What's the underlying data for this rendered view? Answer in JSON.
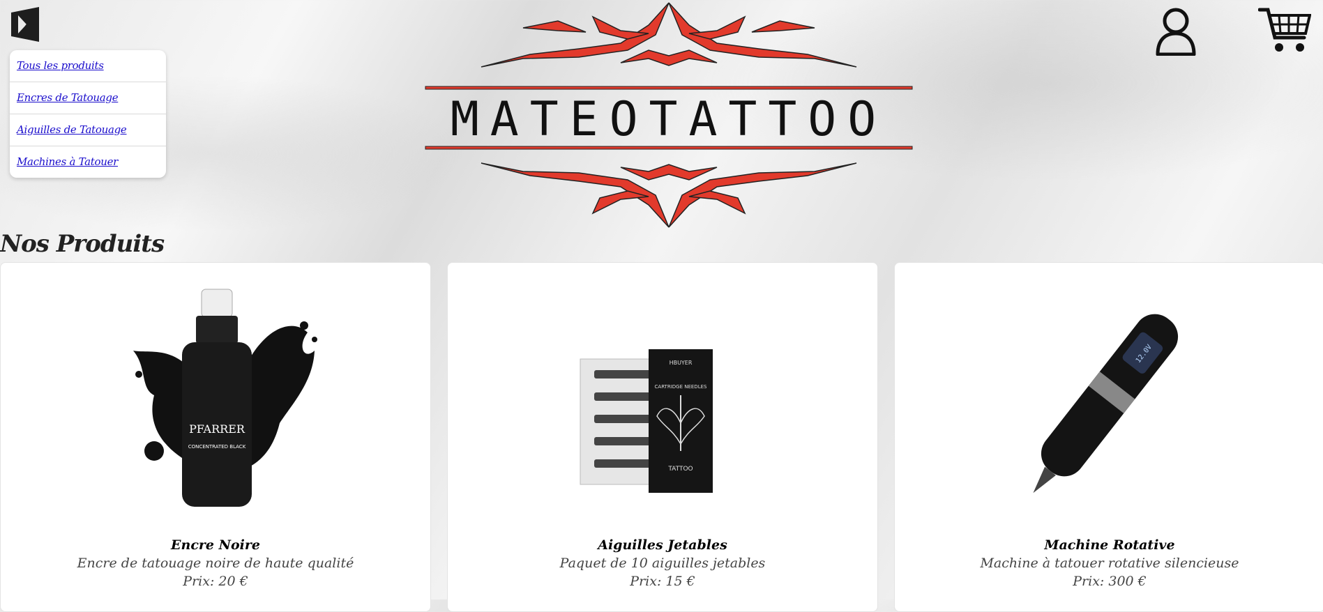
{
  "header": {
    "menu_icon": "close-menu-icon",
    "logo_text": "MATEOTATTOO",
    "user_icon": "user-icon",
    "cart_icon": "cart-icon"
  },
  "menu": {
    "items": [
      {
        "label": "Tous les produits"
      },
      {
        "label": "Encres de Tatouage"
      },
      {
        "label": "Aiguilles de Tatouage"
      },
      {
        "label": "Machines à Tatouer"
      }
    ]
  },
  "main": {
    "title": "Nos Produits",
    "products": [
      {
        "name": "Encre Noire",
        "description": "Encre de tatouage noire de haute qualité",
        "price": "Prix: 20 €",
        "image_label": "PFARRER",
        "image_sublabel": "CONCENTRATED BLACK"
      },
      {
        "name": "Aiguilles Jetables",
        "description": "Paquet de 10 aiguilles jetables",
        "price": "Prix: 15 €",
        "image_label": "HBUYER",
        "image_sublabel": "CARTRIDGE NEEDLES",
        "image_caption": "TATTOO"
      },
      {
        "name": "Machine Rotative",
        "description": "Machine à tatouer rotative silencieuse",
        "price": "Prix: 300 €",
        "image_label": "12.0V"
      }
    ]
  },
  "colors": {
    "logo_red": "#e23a2c",
    "link_blue": "#1a0dcc",
    "text_dark": "#222222"
  }
}
